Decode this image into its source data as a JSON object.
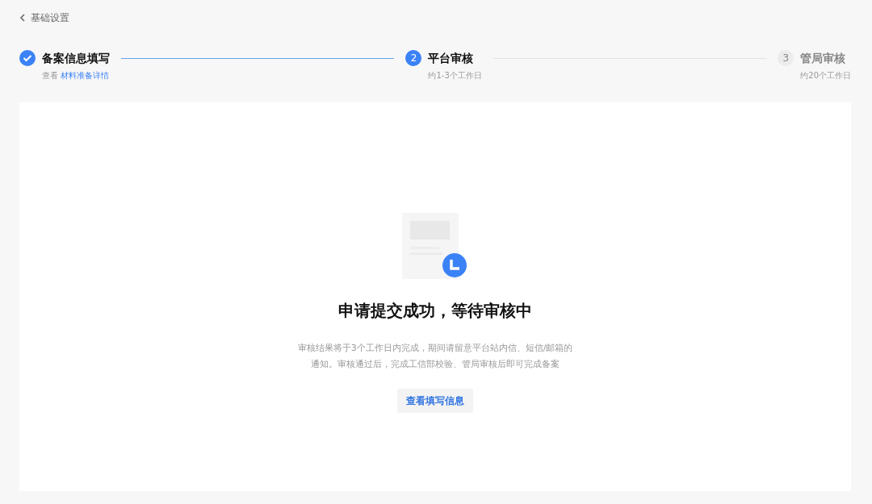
{
  "back_link": {
    "label": "基础设置"
  },
  "steps": [
    {
      "kind": "done",
      "title": "备案信息填写",
      "description": "查看",
      "link": "材料准备详情"
    },
    {
      "kind": "current",
      "number": "2",
      "title": "平台审核",
      "description": "约1-3个工作日"
    },
    {
      "kind": "pending",
      "number": "3",
      "title": "管局审核",
      "description": "约20个工作日"
    }
  ],
  "result": {
    "title": "申请提交成功，等待审核中",
    "description_lines": [
      "审核结果将于3个工作日内完成，期间请留意平台站内信、短信/邮箱的",
      "通知。审核通过后，完成工信部校验、管局审核后即可完成备案"
    ],
    "button": "查看填写信息"
  }
}
